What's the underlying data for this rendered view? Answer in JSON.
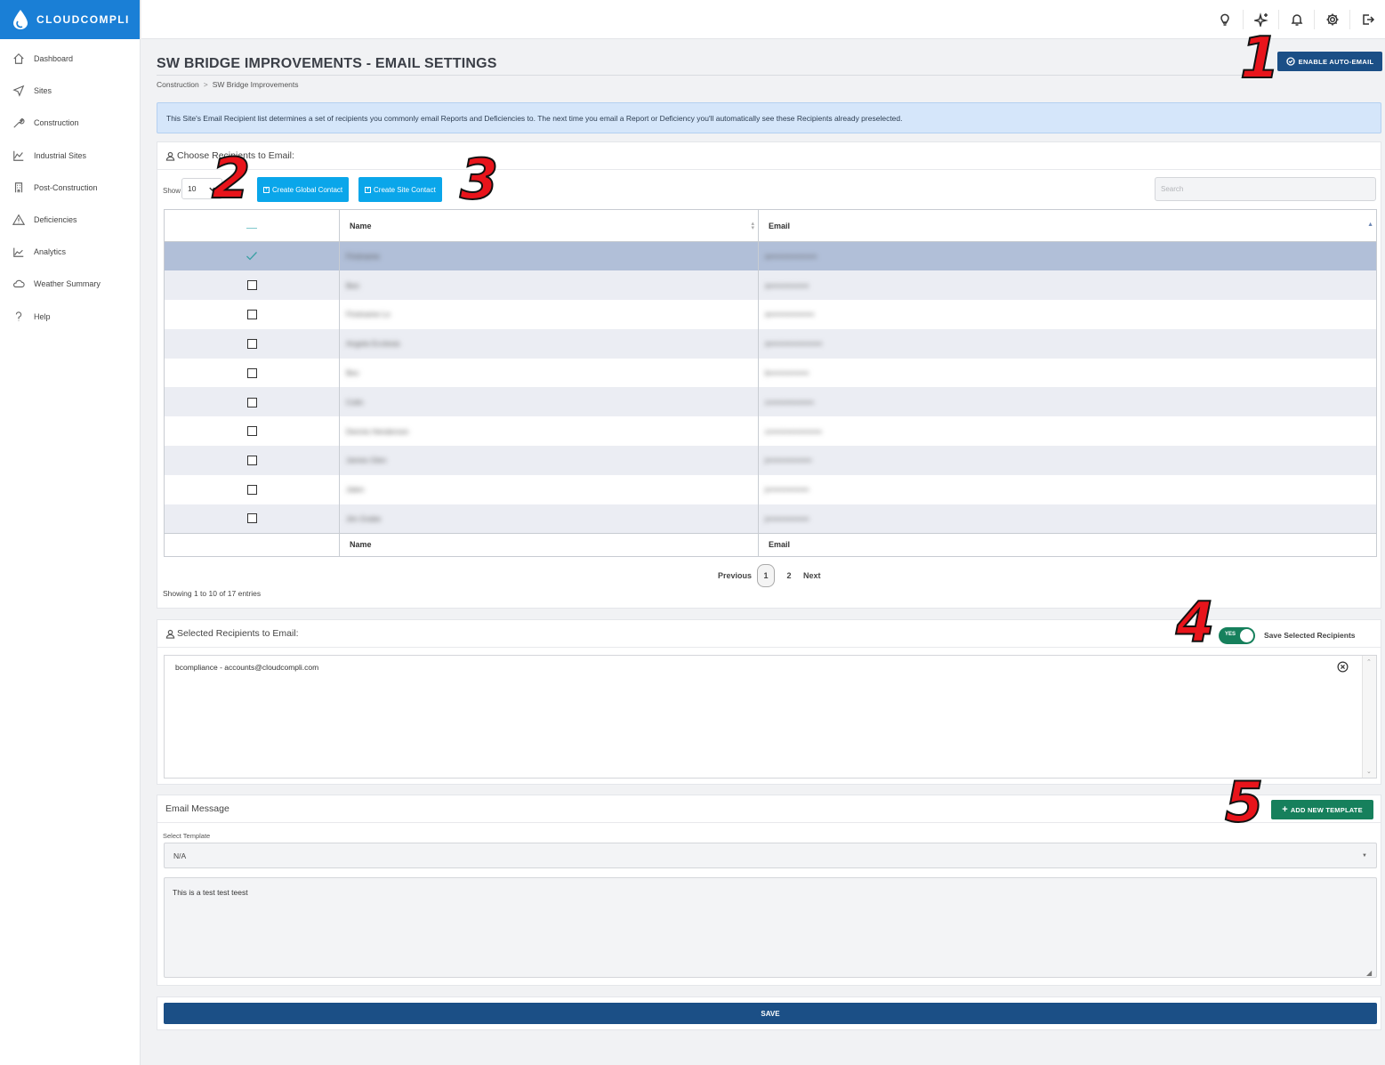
{
  "brand": {
    "name": "CLOUDCOMPLI"
  },
  "sidebar": {
    "items": [
      {
        "label": "Dashboard",
        "icon": "home-icon"
      },
      {
        "label": "Sites",
        "icon": "send-icon"
      },
      {
        "label": "Construction",
        "icon": "wrench-icon"
      },
      {
        "label": "Industrial Sites",
        "icon": "chart-line-icon"
      },
      {
        "label": "Post-Construction",
        "icon": "building-icon"
      },
      {
        "label": "Deficiencies",
        "icon": "warning-icon"
      },
      {
        "label": "Analytics",
        "icon": "analytics-icon"
      },
      {
        "label": "Weather Summary",
        "icon": "cloud-icon"
      },
      {
        "label": "Help",
        "icon": "question-icon"
      }
    ]
  },
  "topbar": {
    "icons": [
      "lightbulb-icon",
      "sparkles-icon",
      "bell-icon",
      "gear-icon",
      "logout-icon"
    ]
  },
  "page": {
    "title": "SW BRIDGE IMPROVEMENTS - EMAIL SETTINGS",
    "breadcrumb": [
      "Construction",
      "SW Bridge Improvements"
    ],
    "breadcrumb_sep": ">",
    "auto_email_label": "ENABLE AUTO-EMAIL",
    "info": "This Site's Email Recipient list determines a set of recipients you commonly email Reports and Deficiencies to. The next time you email a Report or Deficiency you'll automatically see these Recipients already preselected."
  },
  "choose": {
    "title": "Choose Recipients to Email:",
    "show_label": "Show",
    "show_value": "10",
    "create_global": "Create Global Contact",
    "create_site": "Create Site Contact",
    "search_placeholder": "Search",
    "columns": {
      "name": "Name",
      "email": "Email"
    },
    "rows": [
      {
        "checked": true,
        "name": "Firstname",
        "email": "a••••••••••••••••••"
      },
      {
        "checked": false,
        "name": "Ben",
        "email": "a•••••••••••••••"
      },
      {
        "checked": false,
        "name": "Firstname Lo",
        "email": "a•••••••••••••••••"
      },
      {
        "checked": false,
        "name": "Angela Ecclesia",
        "email": "a••••••••••••••••••••"
      },
      {
        "checked": false,
        "name": "Bev",
        "email": "b•••••••••••••••"
      },
      {
        "checked": false,
        "name": "Colin",
        "email": "c•••••••••••••••••"
      },
      {
        "checked": false,
        "name": "Dennis Henderson",
        "email": "c••••••••••••••••••••"
      },
      {
        "checked": false,
        "name": "James Glen",
        "email": "j•••••••••••••••••"
      },
      {
        "checked": false,
        "name": "Jalen",
        "email": "j••••••••••••••••"
      },
      {
        "checked": false,
        "name": "Jim Grabe",
        "email": "j••••••••••••••••"
      }
    ],
    "pager": {
      "previous": "Previous",
      "pages": [
        "1",
        "2"
      ],
      "next": "Next"
    },
    "entries_text": "Showing 1 to 10 of 17 entries"
  },
  "selected": {
    "title": "Selected Recipients to Email:",
    "toggle_label": "YES",
    "save_selected_label": "Save Selected Recipients",
    "recipient": "bcompliance - accounts@cloudcompli.com"
  },
  "message": {
    "title": "Email Message",
    "add_template_label": "ADD NEW TEMPLATE",
    "select_template_label": "Select Template",
    "template_value": "N/A",
    "body": "This is a test test teest"
  },
  "save_label": "SAVE",
  "annotations": [
    "1",
    "2",
    "3",
    "4",
    "5"
  ],
  "colors": {
    "brand_blue": "#1a7fd6",
    "primary_navy": "#1b4f86",
    "cyan": "#0aa6ea",
    "green": "#16805c",
    "annotation_red": "#e8141b"
  }
}
